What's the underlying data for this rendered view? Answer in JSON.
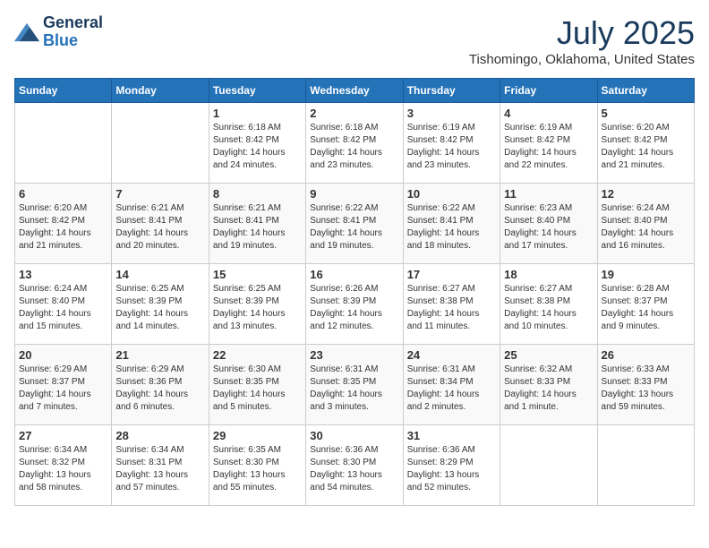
{
  "logo": {
    "line1": "General",
    "line2": "Blue"
  },
  "title": "July 2025",
  "location": "Tishomingo, Oklahoma, United States",
  "headers": [
    "Sunday",
    "Monday",
    "Tuesday",
    "Wednesday",
    "Thursday",
    "Friday",
    "Saturday"
  ],
  "weeks": [
    [
      {
        "day": "",
        "sunrise": "",
        "sunset": "",
        "daylight": ""
      },
      {
        "day": "",
        "sunrise": "",
        "sunset": "",
        "daylight": ""
      },
      {
        "day": "1",
        "sunrise": "Sunrise: 6:18 AM",
        "sunset": "Sunset: 8:42 PM",
        "daylight": "Daylight: 14 hours and 24 minutes."
      },
      {
        "day": "2",
        "sunrise": "Sunrise: 6:18 AM",
        "sunset": "Sunset: 8:42 PM",
        "daylight": "Daylight: 14 hours and 23 minutes."
      },
      {
        "day": "3",
        "sunrise": "Sunrise: 6:19 AM",
        "sunset": "Sunset: 8:42 PM",
        "daylight": "Daylight: 14 hours and 23 minutes."
      },
      {
        "day": "4",
        "sunrise": "Sunrise: 6:19 AM",
        "sunset": "Sunset: 8:42 PM",
        "daylight": "Daylight: 14 hours and 22 minutes."
      },
      {
        "day": "5",
        "sunrise": "Sunrise: 6:20 AM",
        "sunset": "Sunset: 8:42 PM",
        "daylight": "Daylight: 14 hours and 21 minutes."
      }
    ],
    [
      {
        "day": "6",
        "sunrise": "Sunrise: 6:20 AM",
        "sunset": "Sunset: 8:42 PM",
        "daylight": "Daylight: 14 hours and 21 minutes."
      },
      {
        "day": "7",
        "sunrise": "Sunrise: 6:21 AM",
        "sunset": "Sunset: 8:41 PM",
        "daylight": "Daylight: 14 hours and 20 minutes."
      },
      {
        "day": "8",
        "sunrise": "Sunrise: 6:21 AM",
        "sunset": "Sunset: 8:41 PM",
        "daylight": "Daylight: 14 hours and 19 minutes."
      },
      {
        "day": "9",
        "sunrise": "Sunrise: 6:22 AM",
        "sunset": "Sunset: 8:41 PM",
        "daylight": "Daylight: 14 hours and 19 minutes."
      },
      {
        "day": "10",
        "sunrise": "Sunrise: 6:22 AM",
        "sunset": "Sunset: 8:41 PM",
        "daylight": "Daylight: 14 hours and 18 minutes."
      },
      {
        "day": "11",
        "sunrise": "Sunrise: 6:23 AM",
        "sunset": "Sunset: 8:40 PM",
        "daylight": "Daylight: 14 hours and 17 minutes."
      },
      {
        "day": "12",
        "sunrise": "Sunrise: 6:24 AM",
        "sunset": "Sunset: 8:40 PM",
        "daylight": "Daylight: 14 hours and 16 minutes."
      }
    ],
    [
      {
        "day": "13",
        "sunrise": "Sunrise: 6:24 AM",
        "sunset": "Sunset: 8:40 PM",
        "daylight": "Daylight: 14 hours and 15 minutes."
      },
      {
        "day": "14",
        "sunrise": "Sunrise: 6:25 AM",
        "sunset": "Sunset: 8:39 PM",
        "daylight": "Daylight: 14 hours and 14 minutes."
      },
      {
        "day": "15",
        "sunrise": "Sunrise: 6:25 AM",
        "sunset": "Sunset: 8:39 PM",
        "daylight": "Daylight: 14 hours and 13 minutes."
      },
      {
        "day": "16",
        "sunrise": "Sunrise: 6:26 AM",
        "sunset": "Sunset: 8:39 PM",
        "daylight": "Daylight: 14 hours and 12 minutes."
      },
      {
        "day": "17",
        "sunrise": "Sunrise: 6:27 AM",
        "sunset": "Sunset: 8:38 PM",
        "daylight": "Daylight: 14 hours and 11 minutes."
      },
      {
        "day": "18",
        "sunrise": "Sunrise: 6:27 AM",
        "sunset": "Sunset: 8:38 PM",
        "daylight": "Daylight: 14 hours and 10 minutes."
      },
      {
        "day": "19",
        "sunrise": "Sunrise: 6:28 AM",
        "sunset": "Sunset: 8:37 PM",
        "daylight": "Daylight: 14 hours and 9 minutes."
      }
    ],
    [
      {
        "day": "20",
        "sunrise": "Sunrise: 6:29 AM",
        "sunset": "Sunset: 8:37 PM",
        "daylight": "Daylight: 14 hours and 7 minutes."
      },
      {
        "day": "21",
        "sunrise": "Sunrise: 6:29 AM",
        "sunset": "Sunset: 8:36 PM",
        "daylight": "Daylight: 14 hours and 6 minutes."
      },
      {
        "day": "22",
        "sunrise": "Sunrise: 6:30 AM",
        "sunset": "Sunset: 8:35 PM",
        "daylight": "Daylight: 14 hours and 5 minutes."
      },
      {
        "day": "23",
        "sunrise": "Sunrise: 6:31 AM",
        "sunset": "Sunset: 8:35 PM",
        "daylight": "Daylight: 14 hours and 3 minutes."
      },
      {
        "day": "24",
        "sunrise": "Sunrise: 6:31 AM",
        "sunset": "Sunset: 8:34 PM",
        "daylight": "Daylight: 14 hours and 2 minutes."
      },
      {
        "day": "25",
        "sunrise": "Sunrise: 6:32 AM",
        "sunset": "Sunset: 8:33 PM",
        "daylight": "Daylight: 14 hours and 1 minute."
      },
      {
        "day": "26",
        "sunrise": "Sunrise: 6:33 AM",
        "sunset": "Sunset: 8:33 PM",
        "daylight": "Daylight: 13 hours and 59 minutes."
      }
    ],
    [
      {
        "day": "27",
        "sunrise": "Sunrise: 6:34 AM",
        "sunset": "Sunset: 8:32 PM",
        "daylight": "Daylight: 13 hours and 58 minutes."
      },
      {
        "day": "28",
        "sunrise": "Sunrise: 6:34 AM",
        "sunset": "Sunset: 8:31 PM",
        "daylight": "Daylight: 13 hours and 57 minutes."
      },
      {
        "day": "29",
        "sunrise": "Sunrise: 6:35 AM",
        "sunset": "Sunset: 8:30 PM",
        "daylight": "Daylight: 13 hours and 55 minutes."
      },
      {
        "day": "30",
        "sunrise": "Sunrise: 6:36 AM",
        "sunset": "Sunset: 8:30 PM",
        "daylight": "Daylight: 13 hours and 54 minutes."
      },
      {
        "day": "31",
        "sunrise": "Sunrise: 6:36 AM",
        "sunset": "Sunset: 8:29 PM",
        "daylight": "Daylight: 13 hours and 52 minutes."
      },
      {
        "day": "",
        "sunrise": "",
        "sunset": "",
        "daylight": ""
      },
      {
        "day": "",
        "sunrise": "",
        "sunset": "",
        "daylight": ""
      }
    ]
  ]
}
